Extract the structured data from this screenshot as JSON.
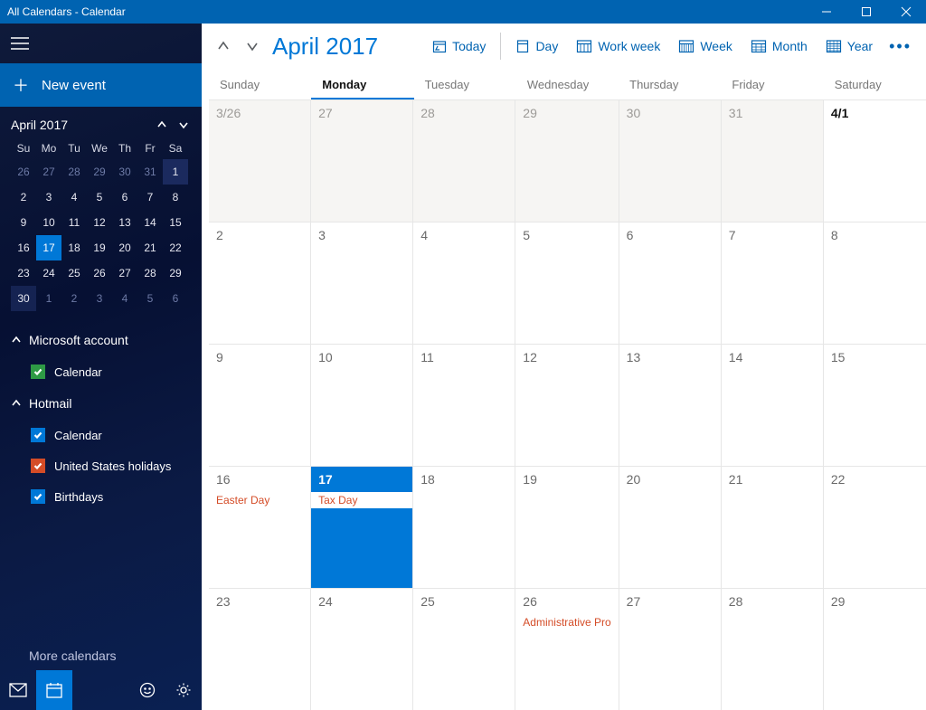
{
  "window": {
    "title": "All Calendars - Calendar"
  },
  "sidebar": {
    "new_event": "New event",
    "mini": {
      "title": "April 2017",
      "dow": [
        "Su",
        "Mo",
        "Tu",
        "We",
        "Th",
        "Fr",
        "Sa"
      ],
      "rows": [
        [
          "26",
          "27",
          "28",
          "29",
          "30",
          "31",
          "1"
        ],
        [
          "2",
          "3",
          "4",
          "5",
          "6",
          "7",
          "8"
        ],
        [
          "9",
          "10",
          "11",
          "12",
          "13",
          "14",
          "15"
        ],
        [
          "16",
          "17",
          "18",
          "19",
          "20",
          "21",
          "22"
        ],
        [
          "23",
          "24",
          "25",
          "26",
          "27",
          "28",
          "29"
        ],
        [
          "30",
          "1",
          "2",
          "3",
          "4",
          "5",
          "6"
        ]
      ]
    },
    "accounts": [
      {
        "name": "Microsoft account",
        "calendars": [
          {
            "label": "Calendar",
            "color": "#2e9a45"
          }
        ]
      },
      {
        "name": "Hotmail",
        "calendars": [
          {
            "label": "Calendar",
            "color": "#0078d7"
          },
          {
            "label": "United States holidays",
            "color": "#d44c27"
          },
          {
            "label": "Birthdays",
            "color": "#0078d7"
          }
        ]
      }
    ],
    "more": "More calendars"
  },
  "toolbar": {
    "month": "April 2017",
    "today": "Today",
    "day": "Day",
    "workweek": "Work week",
    "week": "Week",
    "monthv": "Month",
    "year": "Year"
  },
  "dayhead": [
    "Sunday",
    "Monday",
    "Tuesday",
    "Wednesday",
    "Thursday",
    "Friday",
    "Saturday"
  ],
  "grid": {
    "rows": [
      [
        {
          "n": "3/26",
          "prev": true
        },
        {
          "n": "27",
          "prev": true
        },
        {
          "n": "28",
          "prev": true
        },
        {
          "n": "29",
          "prev": true
        },
        {
          "n": "30",
          "prev": true
        },
        {
          "n": "31",
          "prev": true
        },
        {
          "n": "4/1",
          "first": true
        }
      ],
      [
        {
          "n": "2"
        },
        {
          "n": "3"
        },
        {
          "n": "4"
        },
        {
          "n": "5"
        },
        {
          "n": "6"
        },
        {
          "n": "7"
        },
        {
          "n": "8"
        }
      ],
      [
        {
          "n": "9"
        },
        {
          "n": "10"
        },
        {
          "n": "11"
        },
        {
          "n": "12"
        },
        {
          "n": "13"
        },
        {
          "n": "14"
        },
        {
          "n": "15"
        }
      ],
      [
        {
          "n": "16",
          "evt": "Easter Day"
        },
        {
          "n": "17",
          "sel": true,
          "evt": "Tax Day"
        },
        {
          "n": "18"
        },
        {
          "n": "19"
        },
        {
          "n": "20"
        },
        {
          "n": "21"
        },
        {
          "n": "22"
        }
      ],
      [
        {
          "n": "23"
        },
        {
          "n": "24"
        },
        {
          "n": "25"
        },
        {
          "n": "26",
          "evt": "Administrative Pro"
        },
        {
          "n": "27"
        },
        {
          "n": "28"
        },
        {
          "n": "29"
        }
      ]
    ]
  }
}
